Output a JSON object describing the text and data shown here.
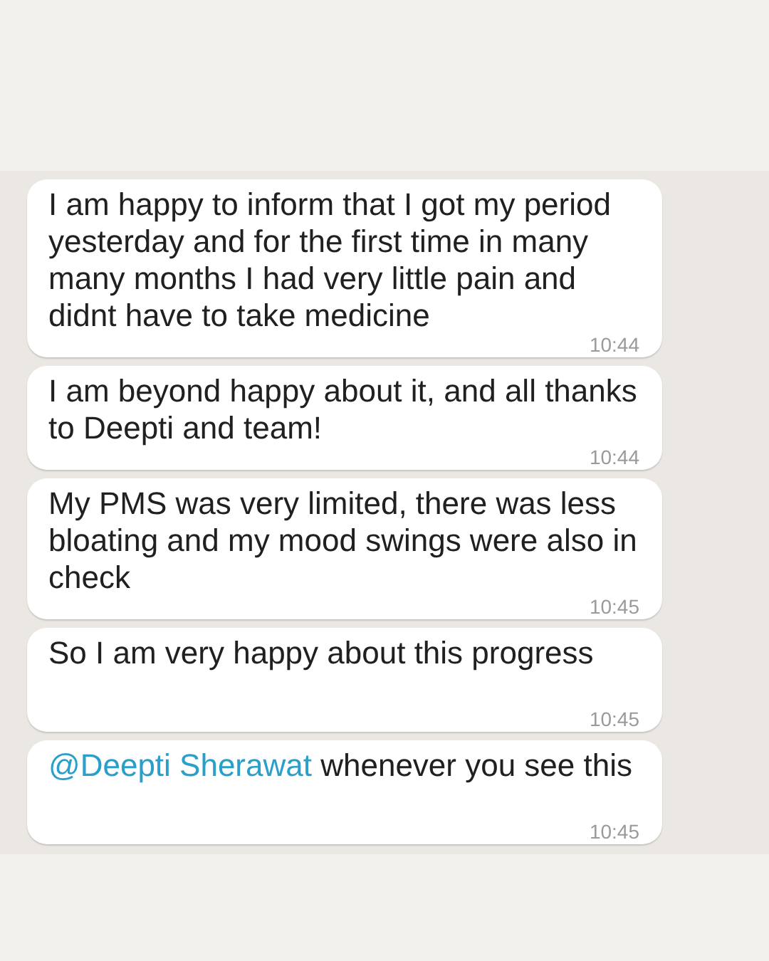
{
  "messages": [
    {
      "text": "I am happy to inform that I got my period yesterday and for the first time in many many months I had very little pain and didnt have to take medicine",
      "time": "10:44"
    },
    {
      "text": "I am beyond happy about it, and all thanks to Deepti and team!",
      "time": "10:44"
    },
    {
      "text": "My PMS was very limited, there was less bloating and my mood swings were also in check",
      "time": "10:45"
    },
    {
      "text": "So I am very happy about this progress",
      "time": "10:45"
    },
    {
      "mention": "@Deepti Sherawat",
      "text": " whenever you see this",
      "time": "10:45"
    }
  ]
}
